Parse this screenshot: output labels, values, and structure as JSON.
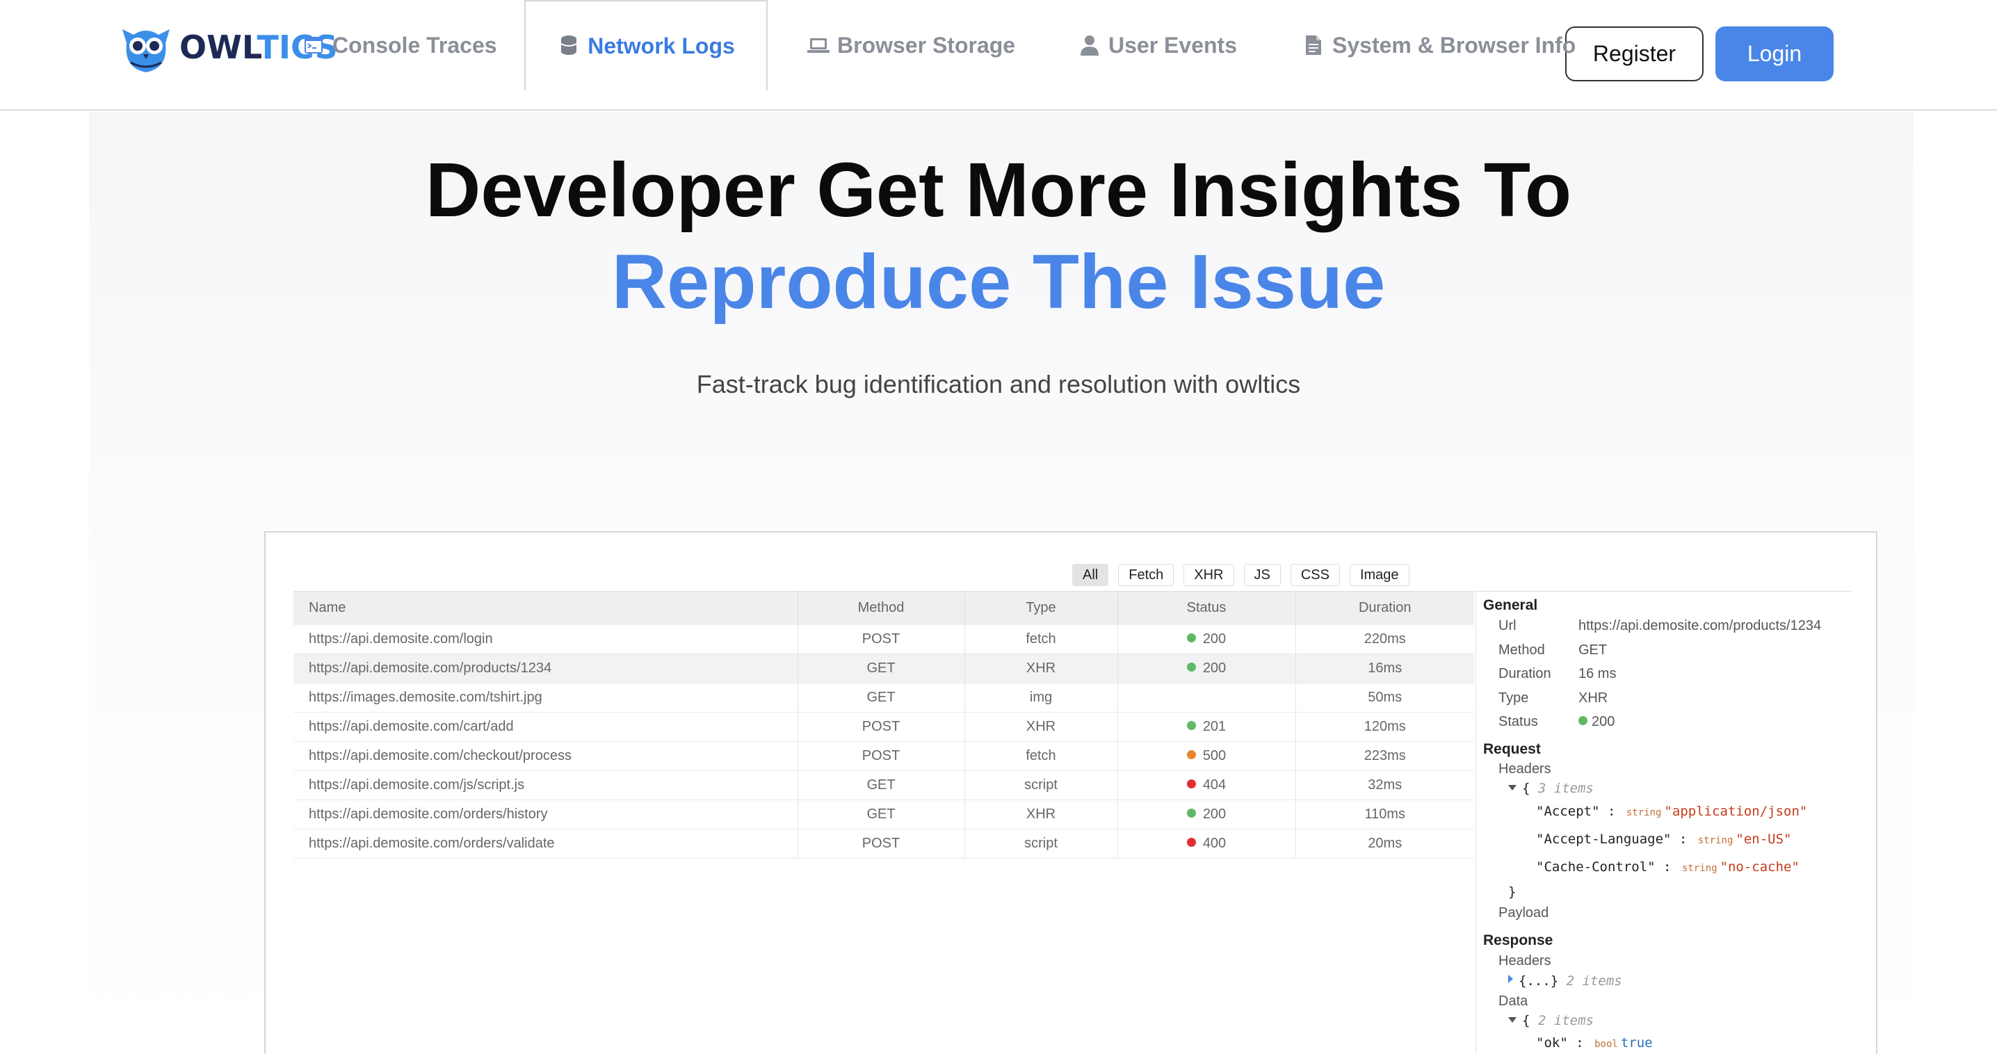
{
  "brand": {
    "part1": "OWL",
    "part2": "TICS",
    "icon": "owl-logo-icon"
  },
  "nav": {
    "register": "Register",
    "login": "Login"
  },
  "hero": {
    "title_line1": "Developer Get More Insights To",
    "title_line2": "Reproduce The Issue",
    "subtitle": "Fast-track bug identification and resolution with owltics"
  },
  "tabs": [
    {
      "label": "Console Traces",
      "icon": "console-icon"
    },
    {
      "label": "Network Logs",
      "icon": "database-icon",
      "active": true
    },
    {
      "label": "Browser Storage",
      "icon": "laptop-icon"
    },
    {
      "label": "User Events",
      "icon": "user-icon"
    },
    {
      "label": "System & Browser Info",
      "icon": "document-icon"
    }
  ],
  "filters": [
    "All",
    "Fetch",
    "XHR",
    "JS",
    "CSS",
    "Image"
  ],
  "table": {
    "headers": [
      "Name",
      "Method",
      "Type",
      "Status",
      "Duration"
    ],
    "rows": [
      {
        "name": "https://api.demosite.com/login",
        "method": "POST",
        "type": "fetch",
        "status": "200",
        "duration": "220ms"
      },
      {
        "name": "https://api.demosite.com/products/1234",
        "method": "GET",
        "type": "XHR",
        "status": "200",
        "duration": "16ms"
      },
      {
        "name": "https://images.demosite.com/tshirt.jpg",
        "method": "GET",
        "type": "img",
        "status": "",
        "duration": "50ms"
      },
      {
        "name": "https://api.demosite.com/cart/add",
        "method": "POST",
        "type": "XHR",
        "status": "201",
        "duration": "120ms"
      },
      {
        "name": "https://api.demosite.com/checkout/process",
        "method": "POST",
        "type": "fetch",
        "status": "500",
        "duration": "223ms"
      },
      {
        "name": "https://api.demosite.com/js/script.js",
        "method": "GET",
        "type": "script",
        "status": "404",
        "duration": "32ms"
      },
      {
        "name": "https://api.demosite.com/orders/history",
        "method": "GET",
        "type": "XHR",
        "status": "200",
        "duration": "110ms"
      },
      {
        "name": "https://api.demosite.com/orders/validate",
        "method": "POST",
        "type": "script",
        "status": "400",
        "duration": "20ms"
      }
    ]
  },
  "status_colors": {
    "ok": "#5fb866",
    "server_error": "#e8842e",
    "client_error": "#e03030"
  },
  "details": {
    "general_title": "General",
    "general": [
      {
        "key": "Url",
        "value": "https://api.demosite.com/products/1234"
      },
      {
        "key": "Method",
        "value": "GET"
      },
      {
        "key": "Duration",
        "value": "16 ms"
      },
      {
        "key": "Type",
        "value": "XHR"
      },
      {
        "key": "Status",
        "value": "200"
      }
    ],
    "request_title": "Request",
    "request_headers_label": "Headers",
    "request_headers_count": "3 items",
    "request_headers": [
      {
        "key": "\"Accept\"",
        "type": "string",
        "value": "\"application/json\""
      },
      {
        "key": "\"Accept-Language\"",
        "type": "string",
        "value": "\"en-US\""
      },
      {
        "key": "\"Cache-Control\"",
        "type": "string",
        "value": "\"no-cache\""
      }
    ],
    "open_brace": "{",
    "close_brace": "}",
    "collapsed_obj": "{...}",
    "payload_label": "Payload",
    "response_title": "Response",
    "response_headers_label": "Headers",
    "response_headers_count": "2 items",
    "data_label": "Data",
    "data_count": "2 items",
    "data_first": {
      "key": "\"ok\"",
      "type": "bool",
      "value": "true"
    },
    "colon": ":"
  },
  "colors": {
    "accent": "#4a86e8",
    "brand_dark": "#1e2a55",
    "brand_light": "#3b8fe8"
  }
}
